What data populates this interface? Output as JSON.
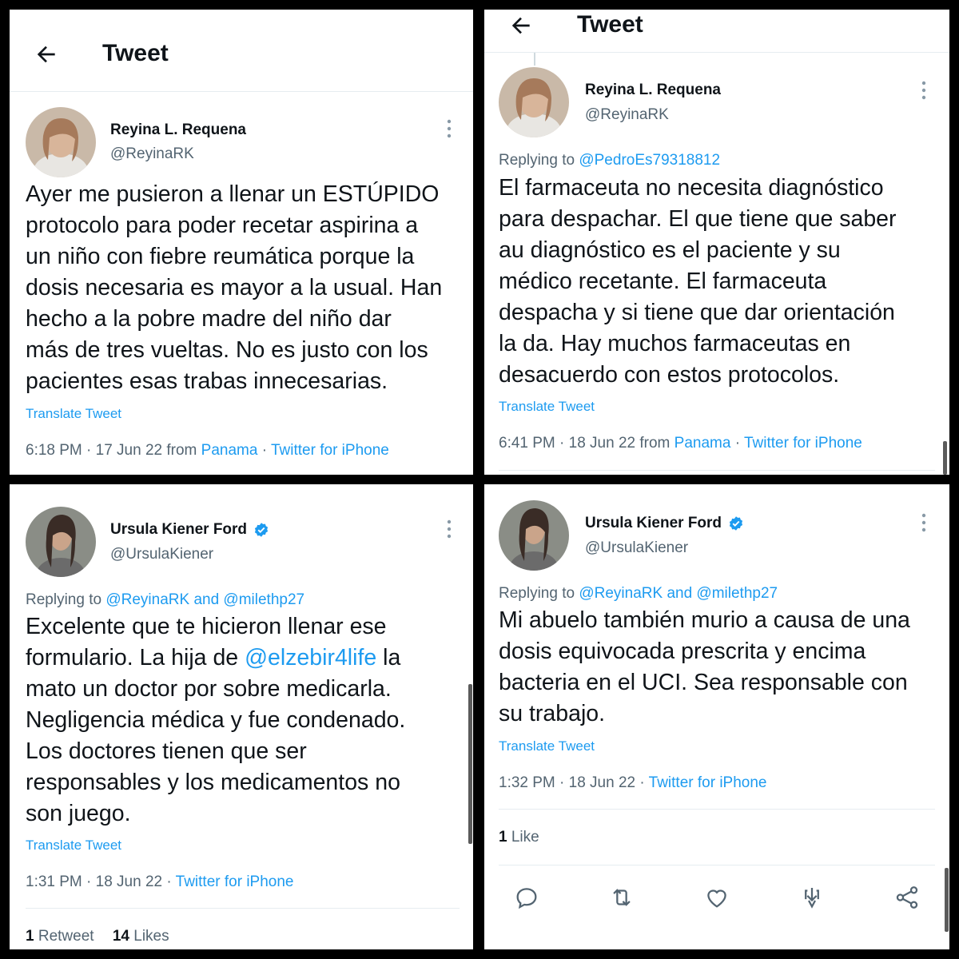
{
  "colors": {
    "link": "#1d9bf0",
    "secondary": "#536471",
    "text": "#0f1419",
    "border": "#e6ecf0"
  },
  "panels": [
    {
      "header_title": "Tweet",
      "user": {
        "name": "Reyina L. Requena",
        "handle": "@ReyinaRK",
        "verified": false
      },
      "text": "Ayer me pusieron a llenar un ESTÚPIDO\nprotocolo para poder recetar aspirina a\nun niño con fiebre reumática porque la\ndosis necesaria es mayor a la usual. Han\nhecho a la pobre madre del niño dar\nmás de tres vueltas. No es justo con los\npacientes esas trabas innecesarias.",
      "translate": "Translate Tweet",
      "time": "6:18 PM · 17 Jun 22 from ",
      "location": "Panama",
      "sep": " · ",
      "source": "Twitter for iPhone"
    },
    {
      "header_title": "Tweet",
      "user": {
        "name": "Reyina L. Requena",
        "handle": "@ReyinaRK",
        "verified": false
      },
      "replying_prefix": "Replying to ",
      "replying_to": "@PedroEs79318812",
      "text": "El farmaceuta no necesita diagnóstico\npara despachar. El que tiene que saber\nau diagnóstico es el paciente y su\nmédico recetante. El farmaceuta\ndespacha y si tiene que dar orientación\nla da. Hay muchos farmaceutas en\ndesacuerdo con estos protocolos.",
      "translate": "Translate Tweet",
      "time": "6:41 PM · 18 Jun 22 from ",
      "location": "Panama",
      "sep": " · ",
      "source": "Twitter for iPhone"
    },
    {
      "user": {
        "name": "Ursula Kiener Ford",
        "handle": "@UrsulaKiener",
        "verified": true
      },
      "replying_prefix": "Replying to ",
      "replying_to": "@ReyinaRK and @milethp27",
      "text_before": "Excelente que te hicieron llenar ese\nformulario. La hija de ",
      "mention": "@elzebir4life",
      "text_after": " la\nmato un doctor por sobre medicarla.\nNegligencia médica y fue condenado.\nLos doctores tienen que ser\nresponsables y los medicamentos no\nson juego.",
      "translate": "Translate Tweet",
      "time": "1:31 PM · 18 Jun 22 · ",
      "source": "Twitter for iPhone",
      "retweets_count": "1",
      "retweets_label": " Retweet",
      "likes_count": "14",
      "likes_label": " Likes"
    },
    {
      "user": {
        "name": "Ursula Kiener Ford",
        "handle": "@UrsulaKiener",
        "verified": true
      },
      "replying_prefix": "Replying to ",
      "replying_to": "@ReyinaRK and @milethp27",
      "text": "Mi abuelo también murio a causa de una\ndosis equivocada prescrita y encima\nbacteria en el UCI. Sea responsable con\nsu trabajo.",
      "translate": "Translate Tweet",
      "time": "1:32 PM · 18 Jun 22 · ",
      "source": "Twitter for iPhone",
      "likes_count": "1",
      "likes_label": " Like",
      "actions": [
        "reply-icon",
        "retweet-icon",
        "like-icon",
        "bookmark-icon",
        "share-icon"
      ]
    }
  ]
}
